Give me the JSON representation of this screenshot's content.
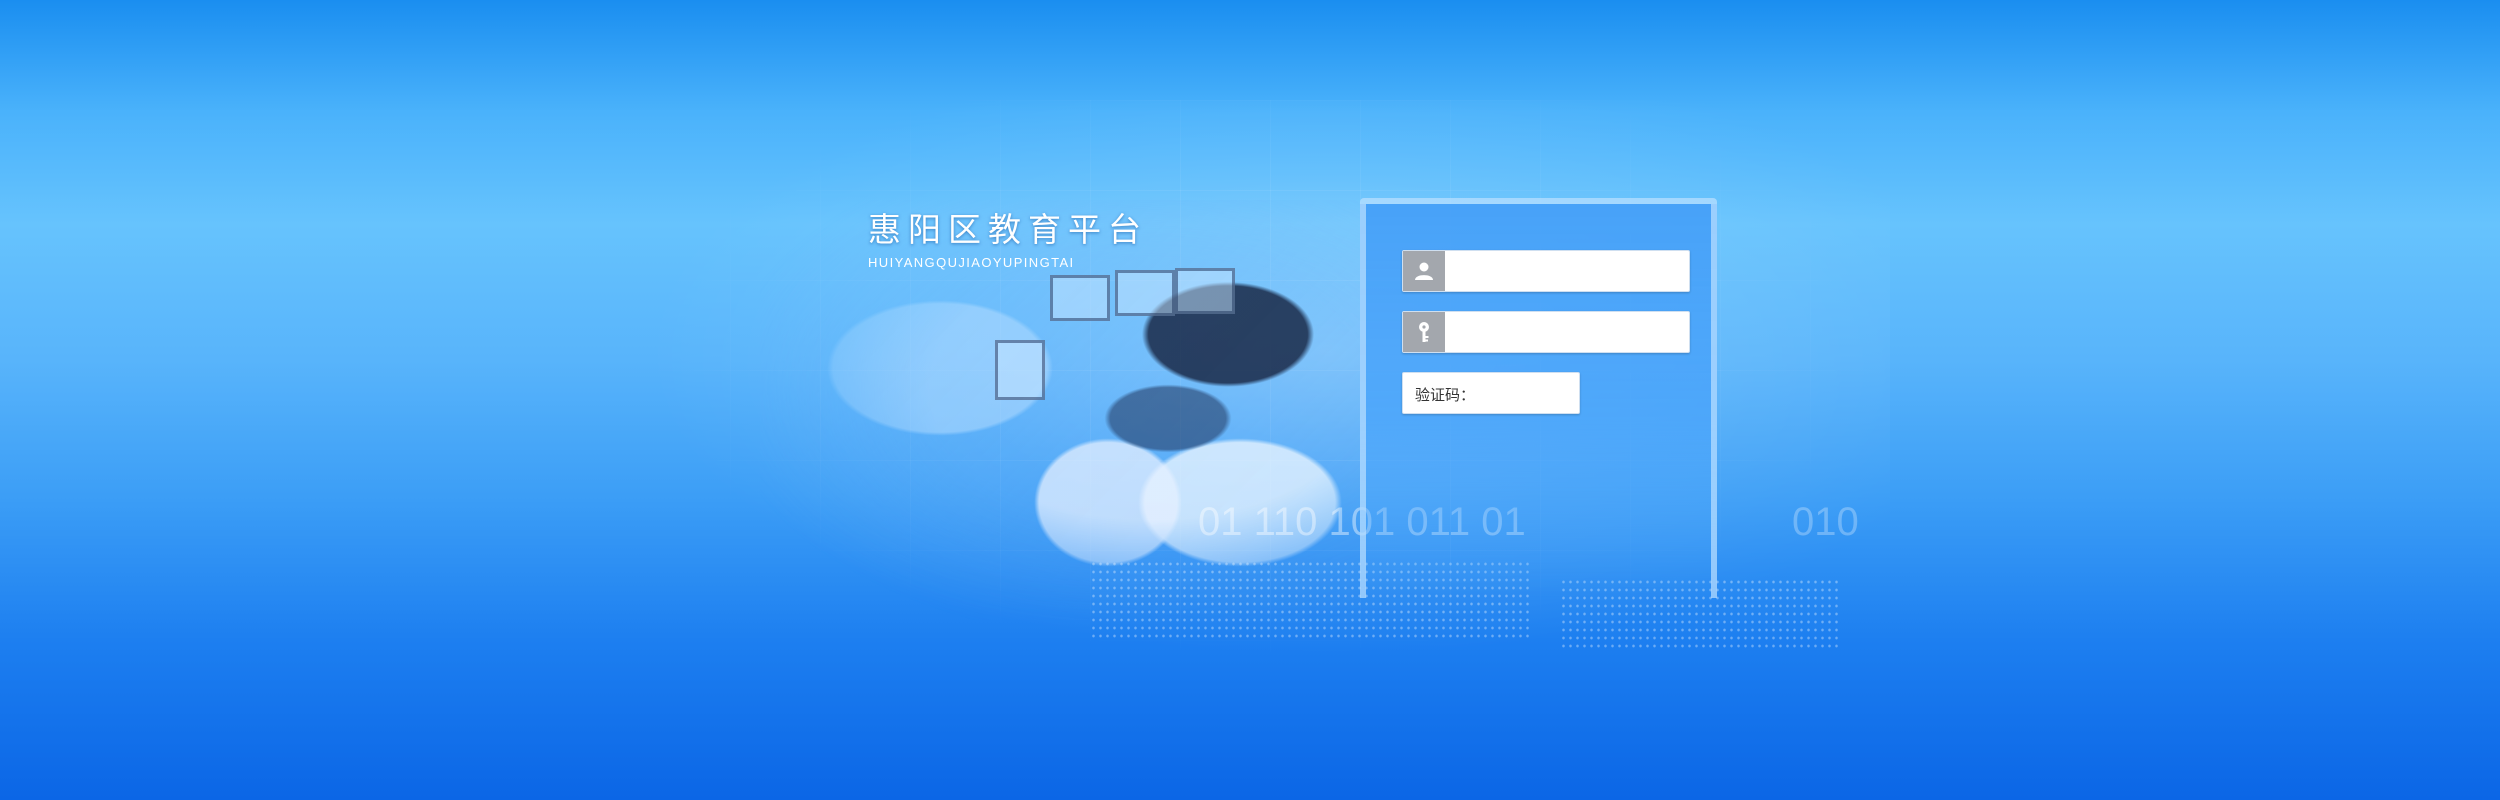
{
  "brand": {
    "title": "惠阳区教育平台",
    "subtitle": "HUIYANGQUJIAOYUPINGTAI"
  },
  "decor": {
    "binary_left": "01  110 101  011  01",
    "binary_right": "010"
  },
  "login": {
    "username": {
      "icon": "user-icon",
      "value": "",
      "placeholder": ""
    },
    "password": {
      "icon": "key-icon",
      "value": "",
      "placeholder": ""
    },
    "captcha": {
      "label": "验证码：",
      "value": ""
    }
  },
  "colors": {
    "background_top": "#1a8ef0",
    "background_bottom": "#0b66e6",
    "panel": "#46a0f8",
    "icon_box": "#a3a7ad"
  }
}
